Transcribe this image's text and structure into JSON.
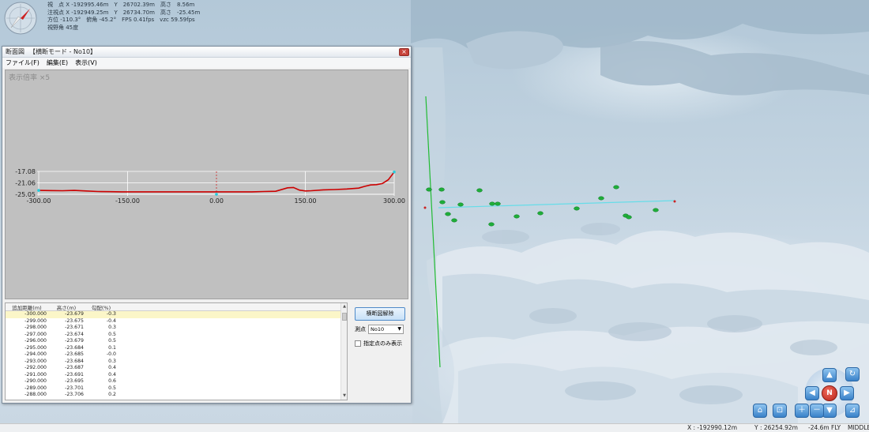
{
  "window": {
    "title_app": "断面図",
    "title_mode": "【横断モード - No10】",
    "close_glyph": "×"
  },
  "menu": [
    "ファイル(F)",
    "編集(E)",
    "表示(V)"
  ],
  "graph": {
    "zoom_label": "表示倍率 ×5"
  },
  "chart_data": {
    "type": "line",
    "title": "",
    "xlabel": "",
    "ylabel": "",
    "x_ticks": [
      "-300.00",
      "-150.00",
      "0.00",
      "150.00",
      "300.00"
    ],
    "y_ticks": [
      "-17.08",
      "-21.06",
      "-25.05"
    ],
    "xlim": [
      -300,
      300
    ],
    "ylim": [
      -25.05,
      -17.08
    ],
    "grid": true,
    "series": [
      {
        "color": "#cc0000",
        "x": [
          -300,
          -280,
          -260,
          -240,
          -220,
          -200,
          -180,
          -160,
          -140,
          -120,
          -100,
          -80,
          -60,
          -40,
          -20,
          0,
          20,
          40,
          60,
          80,
          100,
          120,
          130,
          140,
          150,
          160,
          180,
          200,
          220,
          240,
          250,
          260,
          270,
          280,
          290,
          300
        ],
        "y": [
          -23.7,
          -23.75,
          -23.8,
          -23.7,
          -23.9,
          -24.1,
          -24.15,
          -24.2,
          -24.2,
          -24.2,
          -24.2,
          -24.2,
          -24.2,
          -24.2,
          -24.2,
          -24.2,
          -24.2,
          -24.2,
          -24.2,
          -24.1,
          -24.0,
          -22.8,
          -22.7,
          -23.6,
          -23.9,
          -23.8,
          -23.5,
          -23.4,
          -23.2,
          -22.9,
          -22.3,
          -21.8,
          -21.7,
          -21.3,
          -20.0,
          -17.3
        ]
      }
    ]
  },
  "table": {
    "headers": [
      "追加距離(m)",
      "高さ(m)",
      "勾配(%)"
    ],
    "rows": [
      [
        "-300.000",
        "-23.679",
        "-0.3"
      ],
      [
        "-299.000",
        "-23.675",
        "-0.4"
      ],
      [
        "-298.000",
        "-23.671",
        "0.3"
      ],
      [
        "-297.000",
        "-23.674",
        "0.5"
      ],
      [
        "-296.000",
        "-23.679",
        "0.5"
      ],
      [
        "-295.000",
        "-23.684",
        "0.1"
      ],
      [
        "-294.000",
        "-23.685",
        "-0.0"
      ],
      [
        "-293.000",
        "-23.684",
        "0.3"
      ],
      [
        "-292.000",
        "-23.687",
        "0.4"
      ],
      [
        "-291.000",
        "-23.691",
        "0.4"
      ],
      [
        "-290.000",
        "-23.695",
        "0.6"
      ],
      [
        "-289.000",
        "-23.701",
        "0.5"
      ],
      [
        "-288.000",
        "-23.706",
        "0.2"
      ]
    ],
    "selected_row": 0
  },
  "controls": {
    "release_button": "横断図解除",
    "point_label": "測点",
    "point_value": "No10",
    "only_specified_label": "指定点のみ表示"
  },
  "nav": {
    "north": "N",
    "up": "▲",
    "down": "▼",
    "left": "◀",
    "right": "▶",
    "zoom_in": "＋",
    "zoom_out": "－",
    "rotate": "↻",
    "home": "⌂"
  },
  "status": {
    "x": "X :  -192990.12m",
    "y": "Y :    26254.92m",
    "z": "-24.6m",
    "mode": "FLY",
    "quality": "MIDDLE"
  },
  "colors": {
    "profile_line": "#cc0000",
    "green_axis": "#22bb33",
    "cyan_line": "#66dde8",
    "marker": "#1fae3a",
    "nav_blue": "#3a82c9"
  }
}
